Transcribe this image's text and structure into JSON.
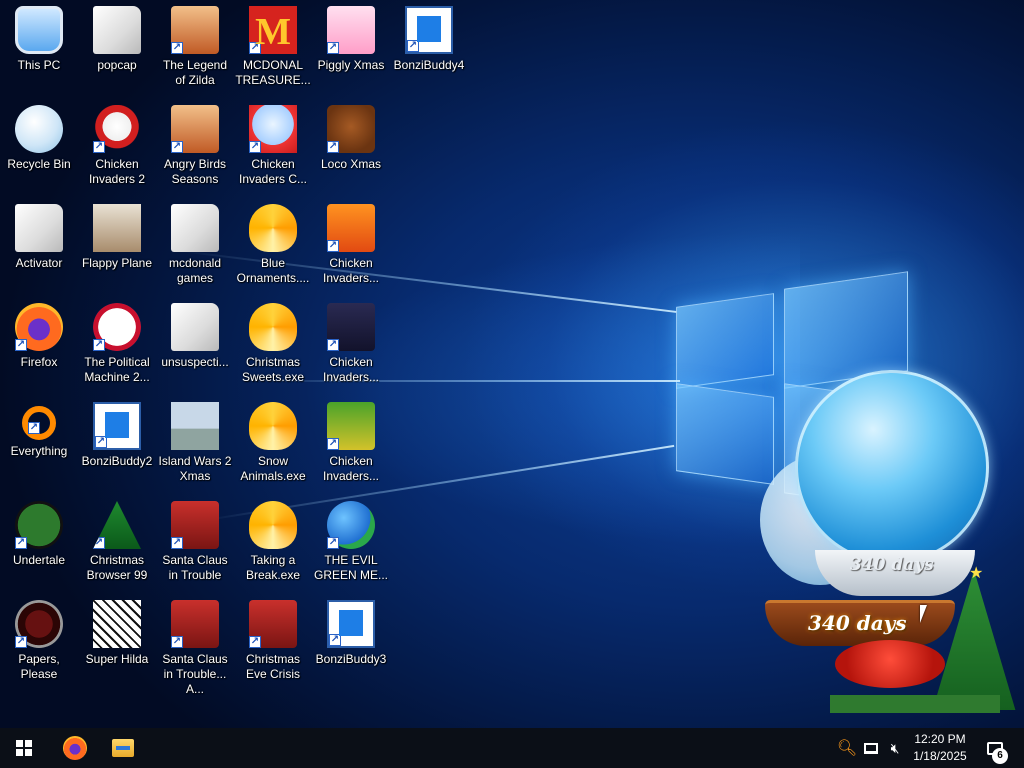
{
  "desktop": {
    "icons": [
      {
        "label": "This PC",
        "icon": "pc-icon",
        "shortcut": false
      },
      {
        "label": "popcap",
        "icon": "folder-icon",
        "shortcut": false
      },
      {
        "label": "The Legend of Zilda",
        "icon": "game-icon",
        "shortcut": true
      },
      {
        "label": "MCDONAL TREASURE...",
        "icon": "mcdonalds-icon",
        "shortcut": true
      },
      {
        "label": "Piggly Xmas",
        "icon": "pig-icon",
        "shortcut": true
      },
      {
        "label": "BonziBuddy4",
        "icon": "bonzibuddy-icon",
        "shortcut": true
      },
      {
        "label": "Recycle Bin",
        "icon": "recycle-bin-icon",
        "shortcut": false
      },
      {
        "label": "Chicken Invaders 2",
        "icon": "chicken-icon",
        "shortcut": true
      },
      {
        "label": "Angry Birds Seasons",
        "icon": "angry-birds-icon",
        "shortcut": true
      },
      {
        "label": "Chicken Invaders C...",
        "icon": "snowman-icon",
        "shortcut": true
      },
      {
        "label": "Loco Xmas",
        "icon": "bear-icon",
        "shortcut": true
      },
      {
        "label": "Activator",
        "icon": "folder-icon",
        "shortcut": false
      },
      {
        "label": "Flappy Plane",
        "icon": "photo-icon",
        "shortcut": false
      },
      {
        "label": "mcdonald games",
        "icon": "folder-icon",
        "shortcut": false
      },
      {
        "label": "Blue Ornaments....",
        "icon": "ornament-icon",
        "shortcut": false
      },
      {
        "label": "Chicken Invaders...",
        "icon": "duck-icon",
        "shortcut": true
      },
      {
        "label": "Firefox",
        "icon": "firefox-icon",
        "shortcut": true
      },
      {
        "label": "The Political Machine 2...",
        "icon": "political-machine-icon",
        "shortcut": true
      },
      {
        "label": "unsuspecti...",
        "icon": "folder-icon",
        "shortcut": false
      },
      {
        "label": "Christmas Sweets.exe",
        "icon": "ornament-icon",
        "shortcut": false
      },
      {
        "label": "Chicken Invaders...",
        "icon": "insects-icon",
        "shortcut": true
      },
      {
        "label": "Everything",
        "icon": "search-icon",
        "shortcut": true
      },
      {
        "label": "BonziBuddy2",
        "icon": "bonzibuddy-icon",
        "shortcut": true
      },
      {
        "label": "Island Wars 2 Xmas",
        "icon": "island-icon",
        "shortcut": false
      },
      {
        "label": "Snow Animals.exe",
        "icon": "ornament-icon",
        "shortcut": false
      },
      {
        "label": "Chicken Invaders...",
        "icon": "parrot-icon",
        "shortcut": true
      },
      {
        "label": "Undertale",
        "icon": "undertale-icon",
        "shortcut": true
      },
      {
        "label": "Christmas Browser 99",
        "icon": "christmas-tree-icon",
        "shortcut": true
      },
      {
        "label": "Santa Claus in Trouble",
        "icon": "santa-icon",
        "shortcut": true
      },
      {
        "label": "Taking a Break.exe",
        "icon": "ornament-icon",
        "shortcut": false
      },
      {
        "label": "THE EVIL GREEN ME...",
        "icon": "msn-icon",
        "shortcut": true
      },
      {
        "label": "Papers, Please",
        "icon": "papers-please-icon",
        "shortcut": true
      },
      {
        "label": "Super Hilda",
        "icon": "hilda-icon",
        "shortcut": false
      },
      {
        "label": "Santa Claus in Trouble... A...",
        "icon": "santa-icon",
        "shortcut": true
      },
      {
        "label": "Christmas Eve Crisis",
        "icon": "santa-icon",
        "shortcut": true
      },
      {
        "label": "BonziBuddy3",
        "icon": "bonzibuddy-icon",
        "shortcut": true
      }
    ]
  },
  "widget": {
    "countdown_top": "340 days",
    "countdown_bottom": "340 days"
  },
  "taskbar": {
    "start_icon": "windows-logo-icon",
    "pinned": [
      "firefox-icon",
      "file-explorer-icon"
    ],
    "tray_icons": [
      "search-tray-icon",
      "network-icon",
      "volume-muted-icon"
    ],
    "time": "12:20 PM",
    "date": "1/18/2025",
    "notification_count": "6"
  }
}
